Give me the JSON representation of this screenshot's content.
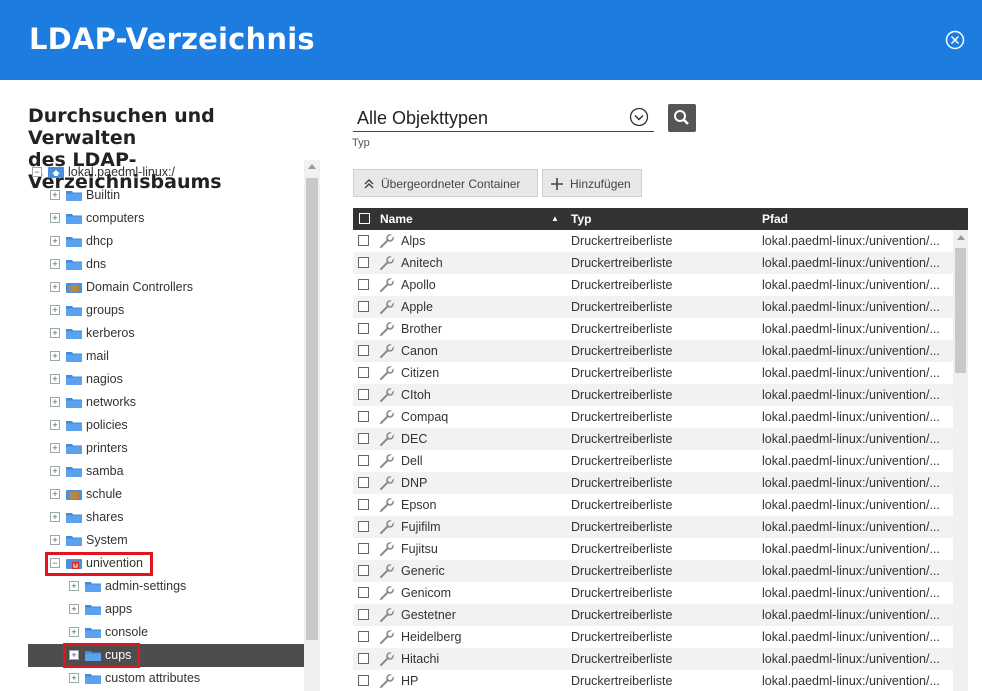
{
  "window": {
    "title": "LDAP-Verzeichnis",
    "close_icon": "close-circle-icon",
    "accent": "#1c7ce0"
  },
  "left": {
    "heading_line1": "Durchsuchen und Verwalten",
    "heading_line2": "des LDAP-Verzeichnisbaums",
    "root": "lokal.paedml-linux:/",
    "tree": [
      {
        "label": "Builtin",
        "level": 1,
        "icon": "folder-icon"
      },
      {
        "label": "computers",
        "level": 1,
        "icon": "folder-icon"
      },
      {
        "label": "dhcp",
        "level": 1,
        "icon": "folder-icon"
      },
      {
        "label": "dns",
        "level": 1,
        "icon": "folder-icon"
      },
      {
        "label": "Domain Controllers",
        "level": 1,
        "icon": "special-folder-icon"
      },
      {
        "label": "groups",
        "level": 1,
        "icon": "folder-icon"
      },
      {
        "label": "kerberos",
        "level": 1,
        "icon": "folder-icon"
      },
      {
        "label": "mail",
        "level": 1,
        "icon": "folder-icon"
      },
      {
        "label": "nagios",
        "level": 1,
        "icon": "folder-icon"
      },
      {
        "label": "networks",
        "level": 1,
        "icon": "folder-icon"
      },
      {
        "label": "policies",
        "level": 1,
        "icon": "folder-icon"
      },
      {
        "label": "printers",
        "level": 1,
        "icon": "folder-icon"
      },
      {
        "label": "samba",
        "level": 1,
        "icon": "folder-icon"
      },
      {
        "label": "schule",
        "level": 1,
        "icon": "special-folder-icon"
      },
      {
        "label": "shares",
        "level": 1,
        "icon": "folder-icon"
      },
      {
        "label": "System",
        "level": 1,
        "icon": "folder-icon"
      },
      {
        "label": "univention",
        "level": 1,
        "icon": "univention-folder-icon",
        "expanded": true
      },
      {
        "label": "admin-settings",
        "level": 2,
        "icon": "folder-icon"
      },
      {
        "label": "apps",
        "level": 2,
        "icon": "folder-icon"
      },
      {
        "label": "console",
        "level": 2,
        "icon": "folder-icon"
      },
      {
        "label": "cups",
        "level": 2,
        "icon": "folder-icon",
        "selected": true
      },
      {
        "label": "custom attributes",
        "level": 2,
        "icon": "folder-icon"
      }
    ]
  },
  "toolbar": {
    "type_value": "Alle Objekttypen",
    "type_label": "Typ",
    "parent_button": "Übergeordneter Container",
    "add_button": "Hinzufügen"
  },
  "grid": {
    "columns": [
      "Name",
      "Typ",
      "Pfad"
    ],
    "sort_indicator": "▲",
    "rows": [
      {
        "name": "Alps",
        "type": "Druckertreiberliste",
        "path": "lokal.paedml-linux:/univention/..."
      },
      {
        "name": "Anitech",
        "type": "Druckertreiberliste",
        "path": "lokal.paedml-linux:/univention/..."
      },
      {
        "name": "Apollo",
        "type": "Druckertreiberliste",
        "path": "lokal.paedml-linux:/univention/..."
      },
      {
        "name": "Apple",
        "type": "Druckertreiberliste",
        "path": "lokal.paedml-linux:/univention/..."
      },
      {
        "name": "Brother",
        "type": "Druckertreiberliste",
        "path": "lokal.paedml-linux:/univention/..."
      },
      {
        "name": "Canon",
        "type": "Druckertreiberliste",
        "path": "lokal.paedml-linux:/univention/..."
      },
      {
        "name": "Citizen",
        "type": "Druckertreiberliste",
        "path": "lokal.paedml-linux:/univention/..."
      },
      {
        "name": "CItoh",
        "type": "Druckertreiberliste",
        "path": "lokal.paedml-linux:/univention/..."
      },
      {
        "name": "Compaq",
        "type": "Druckertreiberliste",
        "path": "lokal.paedml-linux:/univention/..."
      },
      {
        "name": "DEC",
        "type": "Druckertreiberliste",
        "path": "lokal.paedml-linux:/univention/..."
      },
      {
        "name": "Dell",
        "type": "Druckertreiberliste",
        "path": "lokal.paedml-linux:/univention/..."
      },
      {
        "name": "DNP",
        "type": "Druckertreiberliste",
        "path": "lokal.paedml-linux:/univention/..."
      },
      {
        "name": "Epson",
        "type": "Druckertreiberliste",
        "path": "lokal.paedml-linux:/univention/..."
      },
      {
        "name": "Fujifilm",
        "type": "Druckertreiberliste",
        "path": "lokal.paedml-linux:/univention/..."
      },
      {
        "name": "Fujitsu",
        "type": "Druckertreiberliste",
        "path": "lokal.paedml-linux:/univention/..."
      },
      {
        "name": "Generic",
        "type": "Druckertreiberliste",
        "path": "lokal.paedml-linux:/univention/..."
      },
      {
        "name": "Genicom",
        "type": "Druckertreiberliste",
        "path": "lokal.paedml-linux:/univention/..."
      },
      {
        "name": "Gestetner",
        "type": "Druckertreiberliste",
        "path": "lokal.paedml-linux:/univention/..."
      },
      {
        "name": "Heidelberg",
        "type": "Druckertreiberliste",
        "path": "lokal.paedml-linux:/univention/..."
      },
      {
        "name": "Hitachi",
        "type": "Druckertreiberliste",
        "path": "lokal.paedml-linux:/univention/..."
      },
      {
        "name": "HP",
        "type": "Druckertreiberliste",
        "path": "lokal.paedml-linux:/univention/..."
      }
    ]
  },
  "highlight_color": "#e0151e"
}
